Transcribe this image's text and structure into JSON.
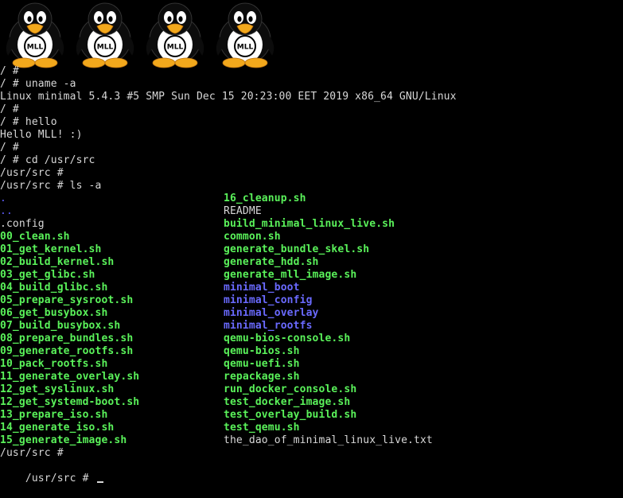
{
  "boot_logo": {
    "count": 4,
    "badge_text": "MLL"
  },
  "terminal": {
    "history": [
      "/ #",
      "/ # uname -a",
      "Linux minimal 5.4.3 #5 SMP Sun Dec 15 20:23:00 EET 2019 x86_64 GNU/Linux",
      "/ #",
      "/ # hello",
      "Hello MLL! :)",
      "/ #",
      "/ # cd /usr/src",
      "/usr/src #",
      "/usr/src # ls -a"
    ],
    "listing": [
      [
        {
          "name": ".",
          "kind": "dir"
        },
        {
          "name": "16_cleanup.sh",
          "kind": "exec"
        }
      ],
      [
        {
          "name": "..",
          "kind": "dir"
        },
        {
          "name": "README",
          "kind": "plain"
        }
      ],
      [
        {
          "name": ".config",
          "kind": "plain"
        },
        {
          "name": "build_minimal_linux_live.sh",
          "kind": "exec"
        }
      ],
      [
        {
          "name": "00_clean.sh",
          "kind": "exec"
        },
        {
          "name": "common.sh",
          "kind": "exec"
        }
      ],
      [
        {
          "name": "01_get_kernel.sh",
          "kind": "exec"
        },
        {
          "name": "generate_bundle_skel.sh",
          "kind": "exec"
        }
      ],
      [
        {
          "name": "02_build_kernel.sh",
          "kind": "exec"
        },
        {
          "name": "generate_hdd.sh",
          "kind": "exec"
        }
      ],
      [
        {
          "name": "03_get_glibc.sh",
          "kind": "exec"
        },
        {
          "name": "generate_mll_image.sh",
          "kind": "exec"
        }
      ],
      [
        {
          "name": "04_build_glibc.sh",
          "kind": "exec"
        },
        {
          "name": "minimal_boot",
          "kind": "dirb"
        }
      ],
      [
        {
          "name": "05_prepare_sysroot.sh",
          "kind": "exec"
        },
        {
          "name": "minimal_config",
          "kind": "dirb"
        }
      ],
      [
        {
          "name": "06_get_busybox.sh",
          "kind": "exec"
        },
        {
          "name": "minimal_overlay",
          "kind": "dirb"
        }
      ],
      [
        {
          "name": "07_build_busybox.sh",
          "kind": "exec"
        },
        {
          "name": "minimal_rootfs",
          "kind": "dirb"
        }
      ],
      [
        {
          "name": "08_prepare_bundles.sh",
          "kind": "exec"
        },
        {
          "name": "qemu-bios-console.sh",
          "kind": "exec"
        }
      ],
      [
        {
          "name": "09_generate_rootfs.sh",
          "kind": "exec"
        },
        {
          "name": "qemu-bios.sh",
          "kind": "exec"
        }
      ],
      [
        {
          "name": "10_pack_rootfs.sh",
          "kind": "exec"
        },
        {
          "name": "qemu-uefi.sh",
          "kind": "exec"
        }
      ],
      [
        {
          "name": "11_generate_overlay.sh",
          "kind": "exec"
        },
        {
          "name": "repackage.sh",
          "kind": "exec"
        }
      ],
      [
        {
          "name": "12_get_syslinux.sh",
          "kind": "exec"
        },
        {
          "name": "run_docker_console.sh",
          "kind": "exec"
        }
      ],
      [
        {
          "name": "12_get_systemd-boot.sh",
          "kind": "exec"
        },
        {
          "name": "test_docker_image.sh",
          "kind": "exec"
        }
      ],
      [
        {
          "name": "13_prepare_iso.sh",
          "kind": "exec"
        },
        {
          "name": "test_overlay_build.sh",
          "kind": "exec"
        }
      ],
      [
        {
          "name": "14_generate_iso.sh",
          "kind": "exec"
        },
        {
          "name": "test_qemu.sh",
          "kind": "exec"
        }
      ],
      [
        {
          "name": "15_generate_image.sh",
          "kind": "exec"
        },
        {
          "name": "the_dao_of_minimal_linux_live.txt",
          "kind": "plain"
        }
      ]
    ],
    "after": [
      "/usr/src #"
    ],
    "prompt": "/usr/src # "
  },
  "colors": {
    "background": "#000000",
    "text": "#d8d8d8",
    "executable": "#5af25a",
    "directory": "#5e5efa"
  }
}
